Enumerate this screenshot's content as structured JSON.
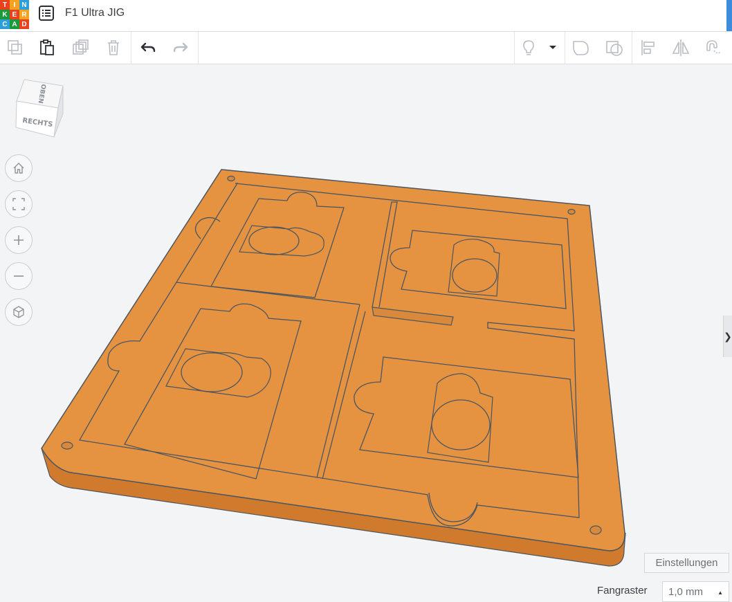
{
  "app": {
    "logo_letters": [
      "T",
      "I",
      "N",
      "K",
      "E",
      "R",
      "C",
      "A",
      "D"
    ],
    "logo_colors": [
      "#e8411e",
      "#f4a21f",
      "#2d9fd8",
      "#1a9a3b",
      "#e8411e",
      "#f4a21f",
      "#2d9fd8",
      "#1a9a3b",
      "#e8411e"
    ],
    "title": "F1 Ultra JIG"
  },
  "viewcube": {
    "top_label": "OBEN",
    "side_label": "RECHTS"
  },
  "footer": {
    "settings_label": "Einstellungen",
    "snap_label": "Fangraster",
    "snap_value": "1,0 mm"
  },
  "side_panel_toggle": "❯",
  "colors": {
    "object_top": "#e59341",
    "object_side": "#cf7a2c",
    "object_edge": "#4b5560",
    "accent": "#3c8ddb"
  }
}
